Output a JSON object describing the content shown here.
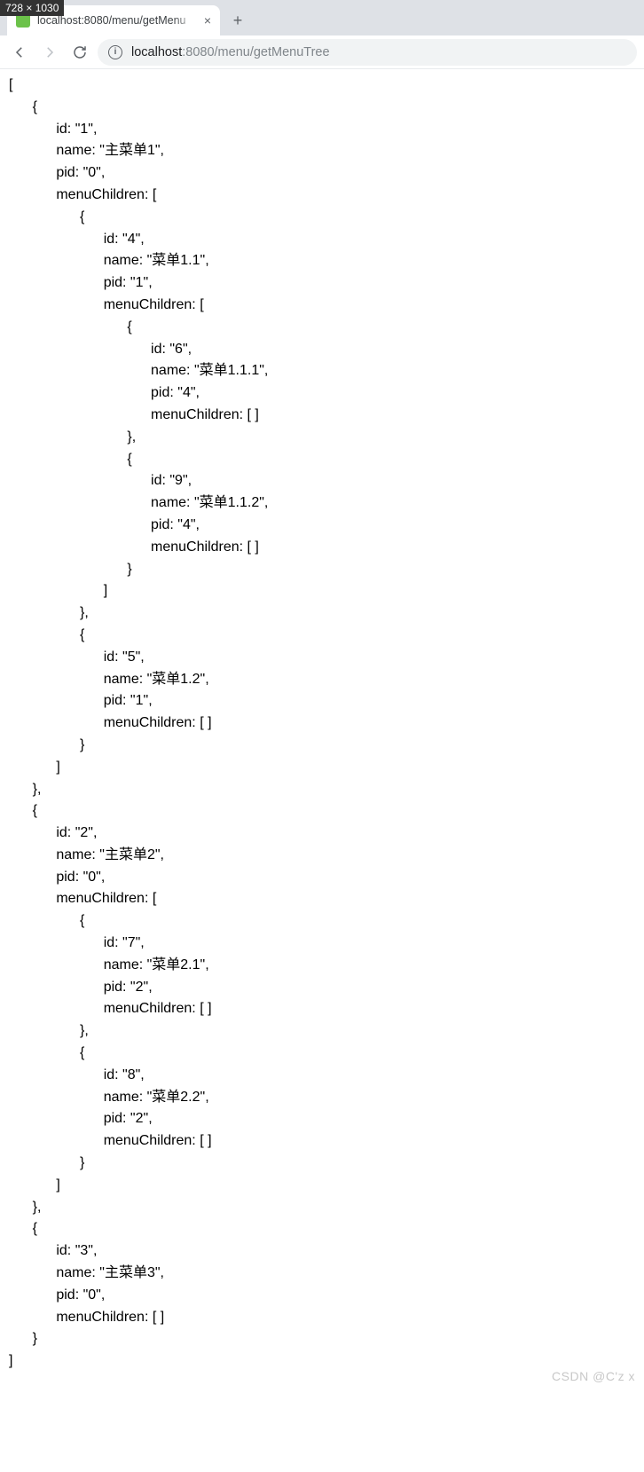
{
  "badge": "728 × 1030",
  "tab": {
    "title": "localhost:8080/menu/getMenu",
    "close_glyph": "×"
  },
  "new_tab_glyph": "+",
  "url": {
    "host": "localhost",
    "port_path": ":8080/menu/getMenuTree"
  },
  "json_tree": [
    {
      "id": "1",
      "name": "主菜单1",
      "pid": "0",
      "menuChildren": [
        {
          "id": "4",
          "name": "菜单1.1",
          "pid": "1",
          "menuChildren": [
            {
              "id": "6",
              "name": "菜单1.1.1",
              "pid": "4",
              "menuChildren": []
            },
            {
              "id": "9",
              "name": "菜单1.1.2",
              "pid": "4",
              "menuChildren": []
            }
          ]
        },
        {
          "id": "5",
          "name": "菜单1.2",
          "pid": "1",
          "menuChildren": []
        }
      ]
    },
    {
      "id": "2",
      "name": "主菜单2",
      "pid": "0",
      "menuChildren": [
        {
          "id": "7",
          "name": "菜单2.1",
          "pid": "2",
          "menuChildren": []
        },
        {
          "id": "8",
          "name": "菜单2.2",
          "pid": "2",
          "menuChildren": []
        }
      ]
    },
    {
      "id": "3",
      "name": "主菜单3",
      "pid": "0",
      "menuChildren": []
    }
  ],
  "watermark": "CSDN @C'z  x"
}
